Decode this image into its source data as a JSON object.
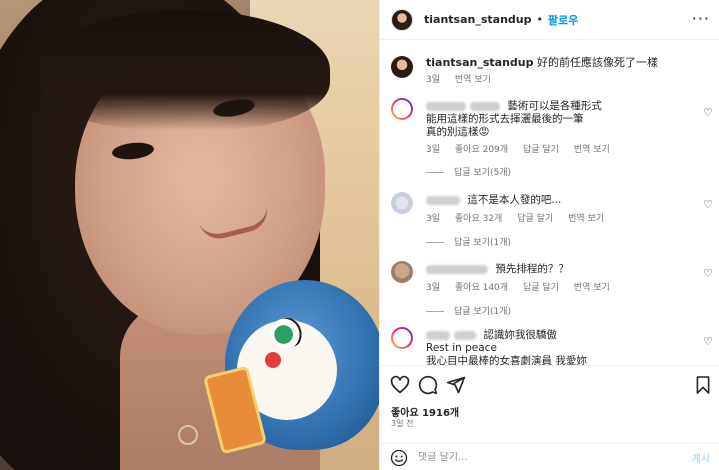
{
  "header": {
    "username": "tiantsan_standup",
    "separator": "•",
    "follow_label": "팔로우",
    "more_icon": "more-horizontal-icon"
  },
  "caption": {
    "username": "tiantsan_standup",
    "text": "好的前任應該像死了一樣",
    "time": "3일",
    "translate": "번역 보기"
  },
  "comments": [
    {
      "line1": "藝術可以是各種形式",
      "line2": "能用這樣的形式去揮灑最後的一筆",
      "line3": "真的別這樣😡",
      "time": "3일",
      "likes": "좋아요 209개",
      "reply": "답글 달기",
      "translate": "번역 보기",
      "view_replies": "답글 보기(5개)"
    },
    {
      "line1": "這不是本人發的吧...",
      "time": "3일",
      "likes": "좋아요 32개",
      "reply": "답글 달기",
      "translate": "번역 보기",
      "view_replies": "답글 보기(1개)"
    },
    {
      "line1": "預先排程的？？",
      "time": "3일",
      "likes": "좋아요 140개",
      "reply": "답글 달기",
      "translate": "번역 보기",
      "view_replies": "답글 보기(1개)"
    },
    {
      "line1": "認識妳我很驕傲",
      "line2": "Rest in peace",
      "line3": "我心目中最棒的女喜劇演員 我愛妳"
    }
  ],
  "footer": {
    "likes": "좋아요 1916개",
    "time": "3일 전",
    "comment_placeholder": "댓글 달기...",
    "post_label": "게시"
  }
}
